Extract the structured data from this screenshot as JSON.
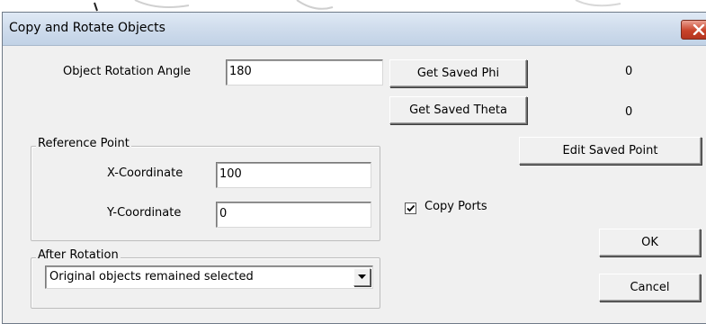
{
  "window": {
    "title": "Copy and Rotate Objects",
    "close_icon": "close-icon"
  },
  "rotation": {
    "label": "Object Rotation Angle",
    "value": "180"
  },
  "saved": {
    "phi_button": "Get Saved Phi",
    "phi_value": "0",
    "theta_button": "Get Saved Theta",
    "theta_value": "0",
    "edit_point_button": "Edit Saved Point"
  },
  "reference_point": {
    "legend": "Reference Point",
    "x_label": "X-Coordinate",
    "x_value": "100",
    "y_label": "Y-Coordinate",
    "y_value": "0"
  },
  "copy_ports": {
    "label": "Copy Ports",
    "checked": true
  },
  "after_rotation": {
    "legend": "After Rotation",
    "selected": "Original objects remained selected"
  },
  "actions": {
    "ok": "OK",
    "cancel": "Cancel"
  }
}
